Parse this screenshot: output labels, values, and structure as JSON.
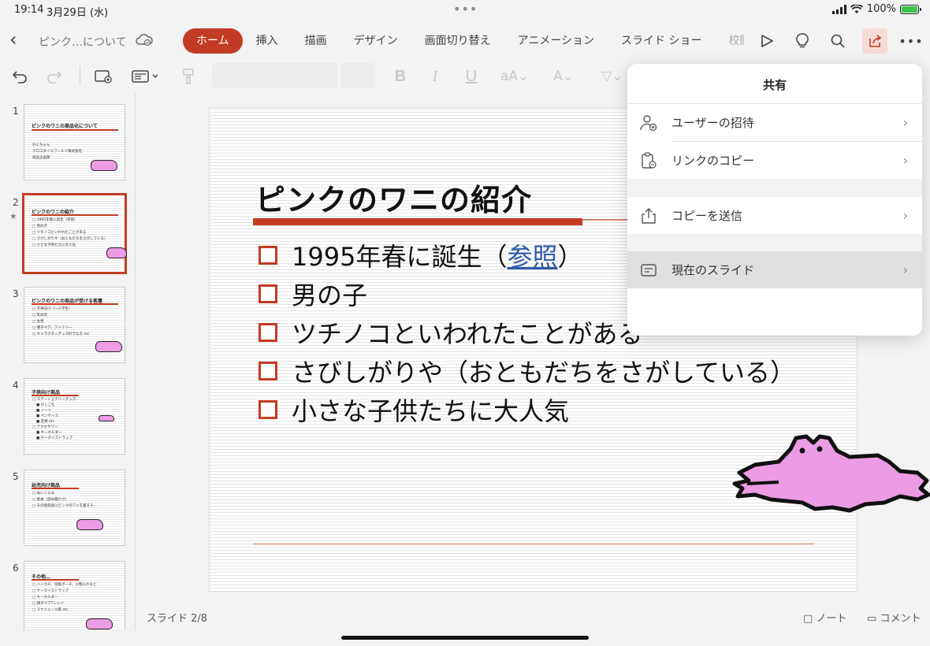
{
  "status_bar": {
    "time": "19:14",
    "date": "3月29日 (水)",
    "battery": "100%"
  },
  "document": {
    "title": "ピンク…について"
  },
  "ribbon_tabs": [
    "ホーム",
    "挿入",
    "描画",
    "デザイン",
    "画面切り替え",
    "アニメーション",
    "スライド ショー",
    "校閲"
  ],
  "active_tab": "ホーム",
  "toolbar": {
    "font_name": "",
    "font_size": ""
  },
  "thumbnails": [
    {
      "num": "1",
      "title": "ピンクのワニの商品化について",
      "lines": [
        "わにちゃん",
        "クロコダイルワールド株式会社",
        "商品企画部"
      ]
    },
    {
      "num": "2",
      "title": "ピンクのワニの紹介",
      "lines": [
        "□ 1995年春に誕生（参照）",
        "□ 男の子",
        "□ ツチノコといわれたことがある",
        "□ さびしがりや（おともだちをさがしている）",
        "□ 小さな子供たちに大人気"
      ]
    },
    {
      "num": "3",
      "title": "ピンクのワニの商品が受ける客層",
      "lines": [
        "□ 子供向け（～小学生）",
        "□ 乳幼児",
        "□ 女性",
        "□ 親子ペア、ファミリー",
        "□ キャラクターグッズ好きな方 etc"
      ]
    },
    {
      "num": "4",
      "title": "子供向け商品",
      "lines": [
        "□ ステーショナリーグッズ",
        "■ けしごむ",
        "■ ノート",
        "■ ペンケース",
        "■ 定規 etc",
        "□ アクセサリー",
        "■ キーホルダー",
        "■ ケータイストラップ"
      ]
    },
    {
      "num": "5",
      "title": "幼児向け商品",
      "lines": [
        "□ ぬいぐるみ",
        "□ 絵本（読み聞かせ）",
        "□ その他玩具にピンクのワニを喜そそ…"
      ]
    },
    {
      "num": "6",
      "title": "その他…",
      "lines": [
        "□ ハンカチ、化粧ポーチ、小物入れなど",
        "□ ケータイストラップ",
        "□ キーホルダー",
        "□ 親子ペアTシャツ",
        "□ スケジュール帳 etc"
      ]
    }
  ],
  "slide": {
    "title": "ピンクのワニの紹介",
    "bullets": [
      {
        "text": "1995年春に誕生（",
        "link": "参照",
        "after": "）"
      },
      {
        "text": "男の子"
      },
      {
        "text": "ツチノコといわれたことがある"
      },
      {
        "text": "さびしがりや（おともだちをさがしている）"
      },
      {
        "text": "小さな子供たちに大人気"
      }
    ]
  },
  "footer": {
    "slide_indicator": "スライド 2/8",
    "notes": "ノート",
    "comments": "コメント"
  },
  "share_popover": {
    "title": "共有",
    "items": [
      {
        "label": "ユーザーの招待",
        "icon": "invite-user-icon"
      },
      {
        "label": "リンクのコピー",
        "icon": "copy-link-icon"
      },
      {
        "label": "コピーを送信",
        "icon": "send-copy-icon"
      },
      {
        "label": "現在のスライド",
        "icon": "current-slide-icon"
      }
    ]
  },
  "colors": {
    "accent": "#c33b24",
    "croc_pink": "#ec9ce5",
    "link": "#2f5aa8"
  }
}
